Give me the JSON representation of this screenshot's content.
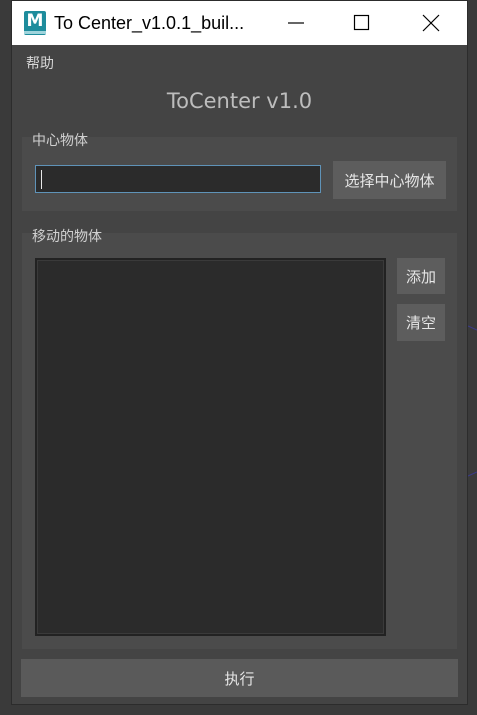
{
  "window": {
    "title": "To Center_v1.0.1_buil...",
    "app_icon_letter": "M",
    "controls": [
      "minimize-icon",
      "maximize-icon",
      "close-icon"
    ]
  },
  "menu": {
    "help_label": "帮助"
  },
  "heading": "ToCenter v1.0",
  "center_object": {
    "group_label": "中心物体",
    "input_value": "",
    "select_button_label": "选择中心物体"
  },
  "moving_objects": {
    "group_label": "移动的物体",
    "items": [],
    "add_button_label": "添加",
    "clear_button_label": "清空"
  },
  "run_button_label": "执行",
  "colors": {
    "window_bg": "#444444",
    "group_bg": "#4b4b4b",
    "button_bg": "#5d5d5d",
    "input_focus_border": "#5f93b8",
    "maya_icon": "#1e8c9c"
  }
}
